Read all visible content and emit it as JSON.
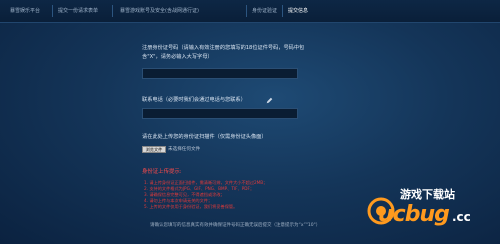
{
  "breadcrumb": {
    "items": [
      "暴雪娱乐平台",
      "提交一份请求表单",
      "暴雪游戏账号及安全(含战网通行证)",
      "身份证验证",
      "提交信息"
    ]
  },
  "form": {
    "id_label_line1": "注册身份证号码（请输入有效注册的您填写的18位证件号码，号码中包",
    "id_label_line2": "含\"X\"，请务必输入大写字母）",
    "id_value": "",
    "phone_label": "联系电话（必要时我们会通过电话与您联系）",
    "phone_value": "",
    "upload_label": "请在此处上传您的身份证扫描件（仅需身份证头像面）",
    "file_button": "浏览文件",
    "file_status": "未选择任何文件"
  },
  "requirements": {
    "title": "身份证上传提示:",
    "lines": [
      "1. 请上传身份证正面扫描件，需清晰可辨，文件大小不超过2MB；",
      "2. 支持的文件格式为JPG、GIF、PNG、BMP、TIF、PDF；",
      "3. 请确保信息完整可见，不得遮挡或涂改；",
      "4. 请勿上传与本次申请无关的文件；",
      "5. 上传的文件仅用于身份验证，我们将妥善保管。"
    ]
  },
  "footer": "请确认您填写的信息真实有效并确保证件号码正确无误后提交（注意提示为“x”\"10\"）",
  "watermark": {
    "top": "游戏下载站",
    "main": "ucbug",
    "domain": ".cc"
  },
  "colors": {
    "background": "#143559",
    "accent_red": "#e23a3a",
    "watermark_orange": "#ff9a1e"
  }
}
